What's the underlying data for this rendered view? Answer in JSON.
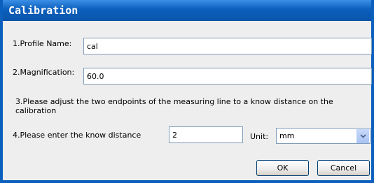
{
  "window": {
    "title": "Calibration"
  },
  "form": {
    "profile_label": "1.Profile Name:",
    "profile_value": "cal",
    "magnification_label": "2.Magnification:",
    "magnification_value": "60.0",
    "instruction": "3.Please adjust the two endpoints of the measuring line to a know distance on the calibration",
    "distance_label": "4.Please enter the know distance",
    "distance_value": "2",
    "unit_label": "Unit:",
    "unit_value": "mm"
  },
  "buttons": {
    "ok": "OK",
    "cancel": "Cancel"
  },
  "colors": {
    "title_bar": "#0b5fbd",
    "panel": "#eeeeee",
    "field_border": "#7f9db9"
  },
  "icons": {
    "dropdown": "chevron-down-icon"
  }
}
